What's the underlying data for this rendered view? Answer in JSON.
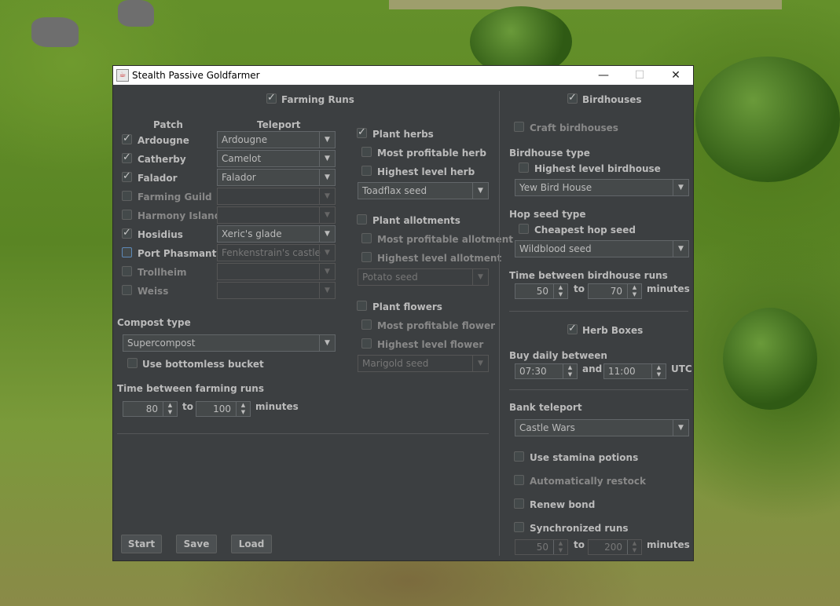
{
  "window": {
    "title": "Stealth Passive Goldfarmer"
  },
  "farming": {
    "header": "Farming Runs",
    "col_patch": "Patch",
    "col_teleport": "Teleport",
    "patches": [
      {
        "name": "Ardougne",
        "teleport": "Ardougne"
      },
      {
        "name": "Catherby",
        "teleport": "Camelot"
      },
      {
        "name": "Falador",
        "teleport": "Falador"
      },
      {
        "name": "Farming Guild",
        "teleport": ""
      },
      {
        "name": "Harmony Island",
        "teleport": ""
      },
      {
        "name": "Hosidius",
        "teleport": "Xeric's glade"
      },
      {
        "name": "Port Phasmantys",
        "teleport": "Fenkenstrain's castle"
      },
      {
        "name": "Trollheim",
        "teleport": ""
      },
      {
        "name": "Weiss",
        "teleport": ""
      }
    ],
    "compost_label": "Compost type",
    "compost_value": "Supercompost",
    "bottomless": "Use bottomless bucket",
    "time_label": "Time between farming runs",
    "time_from": "80",
    "time_to": "100",
    "to": "to",
    "minutes": "minutes",
    "herbs": {
      "header": "Plant herbs",
      "opt1": "Most profitable herb",
      "opt2": "Highest level herb",
      "seed": "Toadflax seed"
    },
    "allotments": {
      "header": "Plant allotments",
      "opt1": "Most profitable allotment",
      "opt2": "Highest level allotment",
      "seed": "Potato seed"
    },
    "flowers": {
      "header": "Plant flowers",
      "opt1": "Most profitable flower",
      "opt2": "Highest level flower",
      "seed": "Marigold seed"
    }
  },
  "buttons": {
    "start": "Start",
    "save": "Save",
    "load": "Load"
  },
  "birdhouses": {
    "header": "Birdhouses",
    "craft": "Craft birdhouses",
    "type_label": "Birdhouse type",
    "highest": "Highest level birdhouse",
    "type_value": "Yew Bird House",
    "hop_label": "Hop seed type",
    "cheapest": "Cheapest hop seed",
    "hop_value": "Wildblood seed",
    "time_label": "Time between birdhouse runs",
    "time_from": "50",
    "time_to": "70",
    "to": "to",
    "minutes": "minutes"
  },
  "herbboxes": {
    "header": "Herb Boxes",
    "buy_label": "Buy daily between",
    "from": "07:30",
    "and": "and",
    "to": "11:00",
    "utc": "UTC"
  },
  "misc": {
    "bank_label": "Bank teleport",
    "bank_value": "Castle Wars",
    "stamina": "Use stamina potions",
    "restock": "Automatically restock",
    "bond": "Renew bond",
    "sync": "Synchronized runs",
    "sync_from": "50",
    "sync_to": "200",
    "to": "to",
    "minutes": "minutes"
  }
}
